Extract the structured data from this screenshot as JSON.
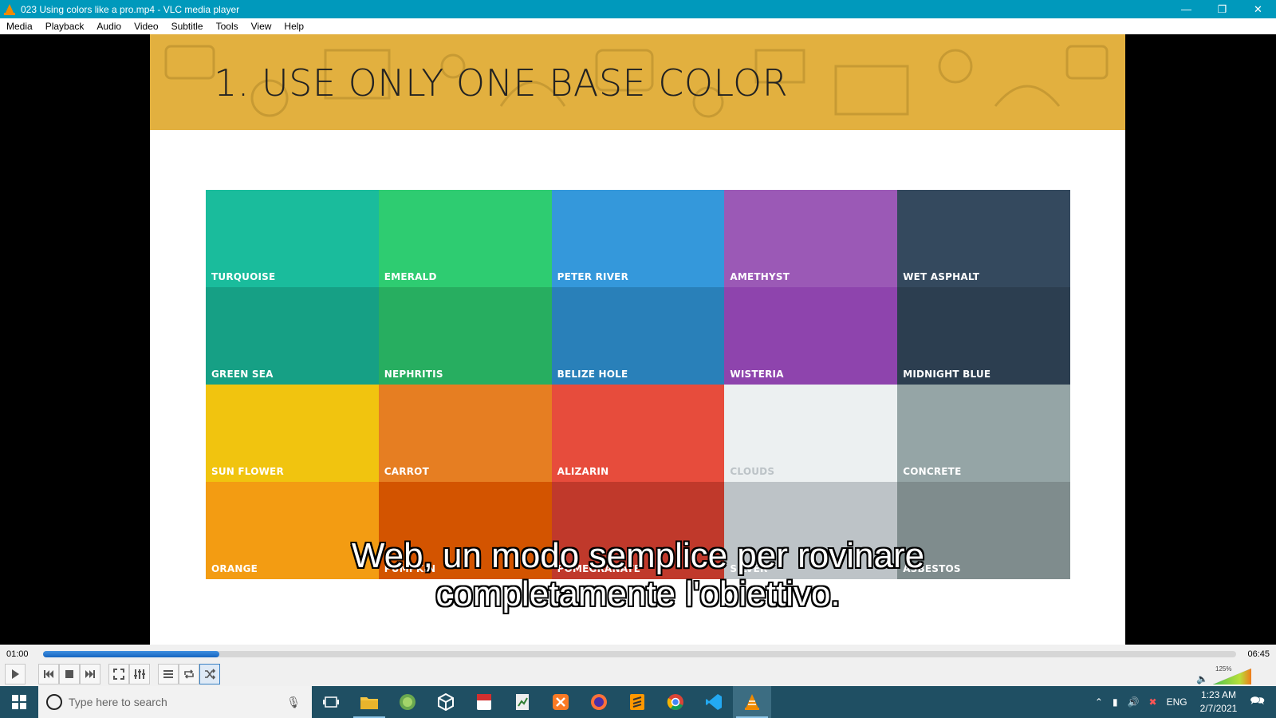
{
  "window": {
    "title": "023 Using colors like a pro.mp4 - VLC media player"
  },
  "menu": [
    "Media",
    "Playback",
    "Audio",
    "Video",
    "Subtitle",
    "Tools",
    "View",
    "Help"
  ],
  "slide": {
    "title": "1. USE ONLY ONE BASE COLOR",
    "swatches": [
      {
        "label": "TURQUOISE",
        "color": "#1abc9c"
      },
      {
        "label": "EMERALD",
        "color": "#2ecc71"
      },
      {
        "label": "PETER RIVER",
        "color": "#3498db"
      },
      {
        "label": "AMETHYST",
        "color": "#9b59b6"
      },
      {
        "label": "WET ASPHALT",
        "color": "#34495e"
      },
      {
        "label": "GREEN SEA",
        "color": "#16a085"
      },
      {
        "label": "NEPHRITIS",
        "color": "#27ae60"
      },
      {
        "label": "BELIZE HOLE",
        "color": "#2980b9"
      },
      {
        "label": "WISTERIA",
        "color": "#8e44ad"
      },
      {
        "label": "MIDNIGHT BLUE",
        "color": "#2c3e50"
      },
      {
        "label": "SUN FLOWER",
        "color": "#f1c40f"
      },
      {
        "label": "CARROT",
        "color": "#e67e22"
      },
      {
        "label": "ALIZARIN",
        "color": "#e74c3c"
      },
      {
        "label": "CLOUDS",
        "color": "#ecf0f1"
      },
      {
        "label": "CONCRETE",
        "color": "#95a5a6"
      },
      {
        "label": "ORANGE",
        "color": "#f39c12"
      },
      {
        "label": "PUMPKIN",
        "color": "#d35400"
      },
      {
        "label": "POMEGRANATE",
        "color": "#c0392b"
      },
      {
        "label": "SILVER",
        "color": "#bdc3c7"
      },
      {
        "label": "ASBESTOS",
        "color": "#7f8c8d"
      }
    ]
  },
  "subtitle": {
    "line1": "Web, un modo semplice per rovinare",
    "line2": "completamente l'obiettivo."
  },
  "player": {
    "current_time": "01:00",
    "total_time": "06:45",
    "progress": 0.148,
    "volume_label": "125%",
    "volume_level": 1.25
  },
  "taskbar": {
    "search_placeholder": "Type here to search",
    "language": "ENG",
    "time": "1:23 AM",
    "date": "2/7/2021"
  }
}
